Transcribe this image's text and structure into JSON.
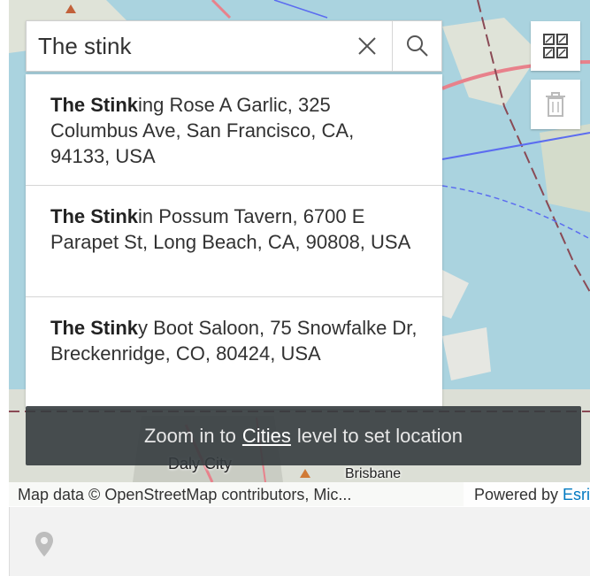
{
  "search": {
    "value": "The stink",
    "clear_icon": "close-icon",
    "search_icon": "search-icon"
  },
  "suggestions": [
    {
      "bold": "The Stink",
      "rest": "ing Rose A Garlic, 325 Columbus Ave, San Francisco, CA, 94133, USA"
    },
    {
      "bold": "The Stink",
      "rest": "in Possum Tavern, 6700 E Parapet St, Long Beach, CA, 90808, USA"
    },
    {
      "bold": "The Stink",
      "rest": "y Boot Saloon, 75 Snowfalke Dr, Breckenridge, CO, 80424, USA"
    }
  ],
  "tools": {
    "draw_icon": "select-area-icon",
    "delete_icon": "trash-icon"
  },
  "toast": {
    "before": "Zoom in to",
    "link": "Cities",
    "after": "level to set location"
  },
  "map": {
    "labels": {
      "daly_city": "Daly City",
      "brisbane": "Brisbane"
    },
    "colors": {
      "water": "#aad3df",
      "land": "#d9dcd6",
      "highway": "#e8818b",
      "transit": "#5b6cf0"
    }
  },
  "attribution": {
    "text": "Map data © OpenStreetMap contributors, Mic...",
    "powered_by": "Powered by",
    "esri": "Esri"
  },
  "footer": {
    "pin_icon": "location-pin-icon"
  }
}
